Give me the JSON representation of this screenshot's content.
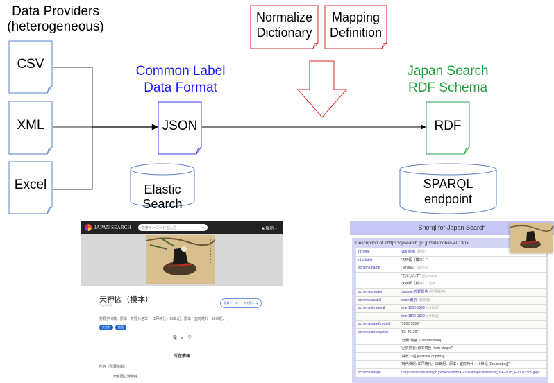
{
  "providers": {
    "heading_line1": "Data Providers",
    "heading_line2": "(heterogeneous)",
    "formats": [
      "CSV",
      "XML",
      "Excel"
    ]
  },
  "common": {
    "title_line1": "Common Label",
    "title_line2": "Data Format",
    "doc": "JSON",
    "store": "Elastic Search",
    "color": "#1a1aff"
  },
  "config_docs": [
    {
      "line1": "Normalize",
      "line2": "Dictionary"
    },
    {
      "line1": "Mapping",
      "line2": "Definition"
    }
  ],
  "rdf": {
    "title_line1": "Japan Search",
    "title_line2": "RDF Schema",
    "doc": "RDF",
    "store_line1": "SPARQL",
    "store_line2": "endpoint",
    "color": "#1e9e3c"
  },
  "japan_search": {
    "brand": "JAPAN SEARCH",
    "search_placeholder": "検索キーワードを入力",
    "user_menu": "■ 展示 ▾",
    "title": "天神図（模本）",
    "kana": "てんじんず",
    "db_button": "収録データベースで表示",
    "meta": "狩野伊川模、原本：狩野元信筆　 江戸時代・19世紀、原本：室町時代・16世紀、 ，",
    "tags": [
      "文化財",
      "絵画"
    ],
    "action_icons": "⎘ ⋖ ♡",
    "section_heading": "所在情報",
    "location_label": "所在（所蔵機関）",
    "location_value": "東京国立博物館"
  },
  "snorql": {
    "header": "Snorql for Japan Search",
    "description": "Description of <https://jpsearch.go.jp/data/cobas-40130>",
    "rows": [
      {
        "prop": "rdf:type",
        "value": "type:絵画",
        "note": "[絵画]",
        "link": true
      },
      {
        "prop": "rdfs:label",
        "value": "\"天神図［模本］\"",
        "note": ""
      },
      {
        "prop": "schema:name",
        "value": "\"Tenjinzu\"",
        "note": "@en-jp"
      },
      {
        "prop": "",
        "value": "\"てんじんず\"",
        "note": "@ja-kana"
      },
      {
        "prop": "",
        "value": "\"天神図［模本］\"",
        "note": "@ja"
      },
      {
        "prop": "schema:creator",
        "value": "chname:狩野探信",
        "note": "(狩野探信)",
        "link": true
      },
      {
        "prop": "schema:spatial",
        "value": "place:東京",
        "note": "(東京都)",
        "link": true
      },
      {
        "prop": "schema:temporal",
        "value": "time:1500-1599",
        "note": "(16世紀)",
        "link": true
      },
      {
        "prop": "",
        "value": "time:1800-1899",
        "note": "(19世紀)",
        "link": true
      },
      {
        "prop": "schema:dateCreated",
        "value": "\"1800-1899\"",
        "note": ""
      },
      {
        "prop": "schema:description",
        "value": "\"ID: 40130\"",
        "note": ""
      },
      {
        "prop": "",
        "value": "\"分類: 絵画 [Classification]\"",
        "note": ""
      },
      {
        "prop": "",
        "value": "\"品質形状: 紙本着色 [Item shape]\"",
        "note": ""
      },
      {
        "prop": "",
        "value": "\"員数: 1幅 [Number of parts]\"",
        "note": ""
      },
      {
        "prop": "",
        "value": "\"時代世紀: 江戸時代・19世紀、原本：室町時代・16世紀 [Era century]\"",
        "note": ""
      },
      {
        "prop": "schema:image",
        "value": "<https://colbase.nich.go.jp/media/tnm/A-2705/image/slideshow_s/A-2705_E00091589.jpg>",
        "note": "",
        "link": true
      }
    ]
  },
  "colors": {
    "provider_doc_border": "#5b7fc4",
    "config_doc_border": "#d22a2a",
    "json_doc_border": "#3a3ae0",
    "rdf_doc_border": "#2aa04a",
    "cylinder_border": "#5b7fc4"
  }
}
